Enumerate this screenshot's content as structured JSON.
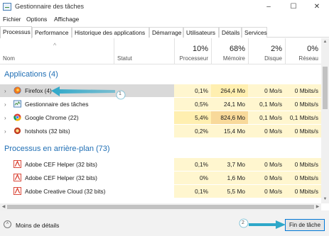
{
  "window": {
    "title": "Gestionnaire des tâches",
    "minimize": "–",
    "maximize": "☐",
    "close": "✕"
  },
  "menu": [
    "Fichier",
    "Options",
    "Affichage"
  ],
  "tabs": [
    "Processus",
    "Performance",
    "Historique des applications",
    "Démarrage",
    "Utilisateurs",
    "Détails",
    "Services"
  ],
  "columns": {
    "name": "Nom",
    "status": "Statut",
    "sort_indicator": "^",
    "cpu": {
      "pct": "10%",
      "label": "Processeur"
    },
    "memory": {
      "pct": "68%",
      "label": "Mémoire"
    },
    "disk": {
      "pct": "2%",
      "label": "Disque"
    },
    "network": {
      "pct": "0%",
      "label": "Réseau"
    }
  },
  "groups": {
    "apps": "Applications (4)",
    "background": "Processus en arrière-plan (73)"
  },
  "apps": [
    {
      "name": "Firefox (4)",
      "icon": "firefox-icon",
      "cpu": "0,1%",
      "mem": "264,4 Mo",
      "disk": "0 Mo/s",
      "net": "0 Mbits/s"
    },
    {
      "name": "Gestionnaire des tâches",
      "icon": "task-manager-icon",
      "cpu": "0,5%",
      "mem": "24,1 Mo",
      "disk": "0,1 Mo/s",
      "net": "0 Mbits/s"
    },
    {
      "name": "Google Chrome (22)",
      "icon": "chrome-icon",
      "cpu": "5,4%",
      "mem": "824,6 Mo",
      "disk": "0,1 Mo/s",
      "net": "0,1 Mbits/s"
    },
    {
      "name": "hotshots (32 bits)",
      "icon": "hotshots-icon",
      "cpu": "0,2%",
      "mem": "15,4 Mo",
      "disk": "0 Mo/s",
      "net": "0 Mbits/s"
    }
  ],
  "background": [
    {
      "name": "Adobe CEF Helper (32 bits)",
      "icon": "adobe-icon",
      "cpu": "0,1%",
      "mem": "3,7 Mo",
      "disk": "0 Mo/s",
      "net": "0 Mbits/s"
    },
    {
      "name": "Adobe CEF Helper (32 bits)",
      "icon": "adobe-icon",
      "cpu": "0%",
      "mem": "1,6 Mo",
      "disk": "0 Mo/s",
      "net": "0 Mbits/s"
    },
    {
      "name": "Adobe Creative Cloud (32 bits)",
      "icon": "adobe-icon",
      "cpu": "0,1%",
      "mem": "5,5 Mo",
      "disk": "0 Mo/s",
      "net": "0 Mbits/s"
    }
  ],
  "annotations": {
    "first": "1",
    "second": "2"
  },
  "footer": {
    "less_details": "Moins de détails",
    "end_task": "Fin de tâche",
    "less_icon": "˄"
  },
  "colors": {
    "group_blue": "#1f6eb4",
    "annotation_arrow": "#2fa8c9",
    "selected_row": "#d9d9d9",
    "heat_light": "#fff6cf",
    "heat_strong": "#f8d99a",
    "button_border": "#0078d7"
  }
}
